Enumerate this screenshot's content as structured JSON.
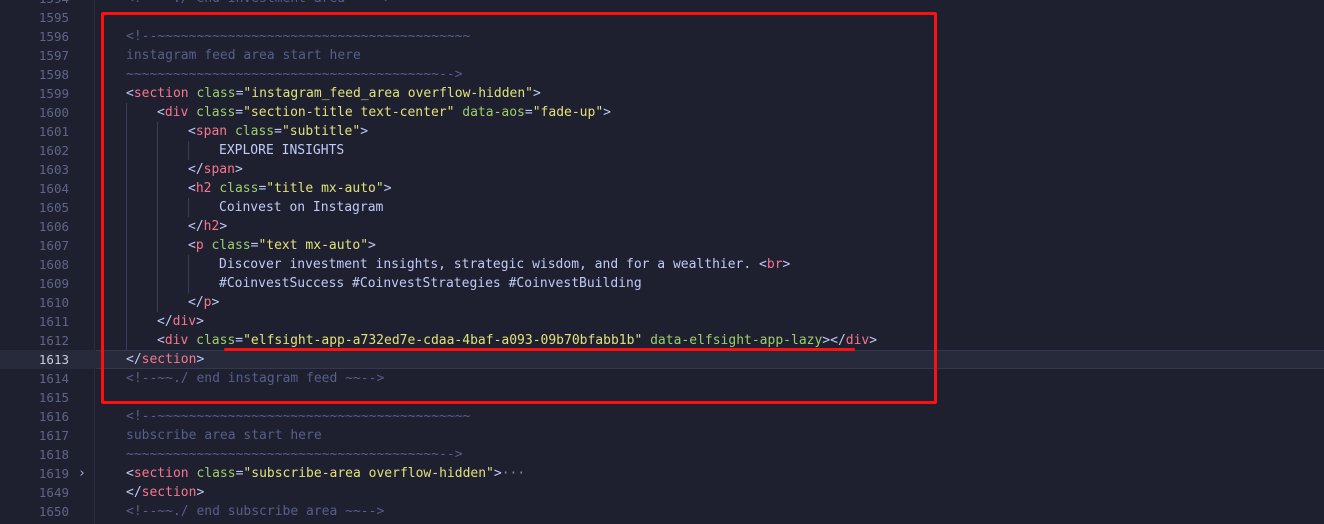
{
  "lines": [
    {
      "n": "1594",
      "indent": 0,
      "parts": [
        {
          "c": "c",
          "t": "<!--~~./ end investment area ~~-->"
        }
      ]
    },
    {
      "n": "1595",
      "indent": 0,
      "parts": []
    },
    {
      "n": "1596",
      "indent": 0,
      "parts": [
        {
          "c": "c",
          "t": "<!--~~~~~~~~~~~~~~~~~~~~~~~~~~~~~~~~~~~~~~~~"
        }
      ]
    },
    {
      "n": "1597",
      "indent": 0,
      "parts": [
        {
          "c": "c",
          "t": "instagram feed area start here"
        }
      ]
    },
    {
      "n": "1598",
      "indent": 0,
      "parts": [
        {
          "c": "c",
          "t": "~~~~~~~~~~~~~~~~~~~~~~~~~~~~~~~~~~~~~~~~-->"
        }
      ]
    },
    {
      "n": "1599",
      "indent": 0,
      "parts": [
        {
          "c": "p",
          "t": "<"
        },
        {
          "c": "t",
          "t": "section"
        },
        {
          "c": "tx",
          "t": " "
        },
        {
          "c": "a",
          "t": "class"
        },
        {
          "c": "p",
          "t": "="
        },
        {
          "c": "s",
          "t": "\"instagram_feed_area overflow-hidden\""
        },
        {
          "c": "p",
          "t": ">"
        }
      ]
    },
    {
      "n": "1600",
      "indent": 1,
      "parts": [
        {
          "c": "p",
          "t": "<"
        },
        {
          "c": "t",
          "t": "div"
        },
        {
          "c": "tx",
          "t": " "
        },
        {
          "c": "a",
          "t": "class"
        },
        {
          "c": "p",
          "t": "="
        },
        {
          "c": "s",
          "t": "\"section-title text-center\""
        },
        {
          "c": "tx",
          "t": " "
        },
        {
          "c": "a",
          "t": "data-aos"
        },
        {
          "c": "p",
          "t": "="
        },
        {
          "c": "s",
          "t": "\"fade-up\""
        },
        {
          "c": "p",
          "t": ">"
        }
      ]
    },
    {
      "n": "1601",
      "indent": 2,
      "parts": [
        {
          "c": "p",
          "t": "<"
        },
        {
          "c": "t",
          "t": "span"
        },
        {
          "c": "tx",
          "t": " "
        },
        {
          "c": "a",
          "t": "class"
        },
        {
          "c": "p",
          "t": "="
        },
        {
          "c": "s",
          "t": "\"subtitle\""
        },
        {
          "c": "p",
          "t": ">"
        }
      ]
    },
    {
      "n": "1602",
      "indent": 3,
      "parts": [
        {
          "c": "tx",
          "t": "EXPLORE INSIGHTS"
        }
      ]
    },
    {
      "n": "1603",
      "indent": 2,
      "parts": [
        {
          "c": "p",
          "t": "</"
        },
        {
          "c": "t",
          "t": "span"
        },
        {
          "c": "p",
          "t": ">"
        }
      ]
    },
    {
      "n": "1604",
      "indent": 2,
      "parts": [
        {
          "c": "p",
          "t": "<"
        },
        {
          "c": "t",
          "t": "h2"
        },
        {
          "c": "tx",
          "t": " "
        },
        {
          "c": "a",
          "t": "class"
        },
        {
          "c": "p",
          "t": "="
        },
        {
          "c": "s",
          "t": "\"title mx-auto\""
        },
        {
          "c": "p",
          "t": ">"
        }
      ]
    },
    {
      "n": "1605",
      "indent": 3,
      "parts": [
        {
          "c": "tx",
          "t": "Coinvest on Instagram"
        }
      ]
    },
    {
      "n": "1606",
      "indent": 2,
      "parts": [
        {
          "c": "p",
          "t": "</"
        },
        {
          "c": "t",
          "t": "h2"
        },
        {
          "c": "p",
          "t": ">"
        }
      ]
    },
    {
      "n": "1607",
      "indent": 2,
      "parts": [
        {
          "c": "p",
          "t": "<"
        },
        {
          "c": "t",
          "t": "p"
        },
        {
          "c": "tx",
          "t": " "
        },
        {
          "c": "a",
          "t": "class"
        },
        {
          "c": "p",
          "t": "="
        },
        {
          "c": "s",
          "t": "\"text mx-auto\""
        },
        {
          "c": "p",
          "t": ">"
        }
      ]
    },
    {
      "n": "1608",
      "indent": 3,
      "parts": [
        {
          "c": "tx",
          "t": "Discover investment insights, strategic wisdom, and for a wealthier. "
        },
        {
          "c": "p",
          "t": "<"
        },
        {
          "c": "t",
          "t": "br"
        },
        {
          "c": "p",
          "t": ">"
        }
      ]
    },
    {
      "n": "1609",
      "indent": 3,
      "parts": [
        {
          "c": "tx",
          "t": "#CoinvestSuccess #CoinvestStrategies #CoinvestBuilding"
        }
      ]
    },
    {
      "n": "1610",
      "indent": 2,
      "parts": [
        {
          "c": "p",
          "t": "</"
        },
        {
          "c": "t",
          "t": "p"
        },
        {
          "c": "p",
          "t": ">"
        }
      ]
    },
    {
      "n": "1611",
      "indent": 1,
      "parts": [
        {
          "c": "p",
          "t": "</"
        },
        {
          "c": "t",
          "t": "div"
        },
        {
          "c": "p",
          "t": ">"
        }
      ]
    },
    {
      "n": "1612",
      "indent": 1,
      "parts": [
        {
          "c": "p",
          "t": "<"
        },
        {
          "c": "t",
          "t": "div"
        },
        {
          "c": "tx",
          "t": " "
        },
        {
          "c": "a",
          "t": "class"
        },
        {
          "c": "p",
          "t": "="
        },
        {
          "c": "s",
          "t": "\"elfsight-app-a732ed7e-cdaa-4baf-a093-09b70bfabb1b\""
        },
        {
          "c": "tx",
          "t": " "
        },
        {
          "c": "a",
          "t": "data-elfsight-app-lazy"
        },
        {
          "c": "p",
          "t": "></"
        },
        {
          "c": "t",
          "t": "div"
        },
        {
          "c": "p",
          "t": ">"
        }
      ]
    },
    {
      "n": "1613",
      "indent": 0,
      "current": true,
      "parts": [
        {
          "c": "p",
          "t": "</"
        },
        {
          "c": "t",
          "t": "section"
        },
        {
          "c": "p",
          "t": ">"
        }
      ]
    },
    {
      "n": "1614",
      "indent": 0,
      "parts": [
        {
          "c": "c",
          "t": "<!--~~./ end instagram feed ~~-->"
        }
      ]
    },
    {
      "n": "1615",
      "indent": 0,
      "parts": []
    },
    {
      "n": "1616",
      "indent": 0,
      "parts": [
        {
          "c": "c",
          "t": "<!--~~~~~~~~~~~~~~~~~~~~~~~~~~~~~~~~~~~~~~~~"
        }
      ]
    },
    {
      "n": "1617",
      "indent": 0,
      "parts": [
        {
          "c": "c",
          "t": "subscribe area start here"
        }
      ]
    },
    {
      "n": "1618",
      "indent": 0,
      "parts": [
        {
          "c": "c",
          "t": "~~~~~~~~~~~~~~~~~~~~~~~~~~~~~~~~~~~~~~~~-->"
        }
      ]
    },
    {
      "n": "1619",
      "indent": 0,
      "folded": true,
      "parts": [
        {
          "c": "p",
          "t": "<"
        },
        {
          "c": "t",
          "t": "section"
        },
        {
          "c": "tx",
          "t": " "
        },
        {
          "c": "a",
          "t": "class"
        },
        {
          "c": "p",
          "t": "="
        },
        {
          "c": "s",
          "t": "\"subscribe-area overflow-hidden\""
        },
        {
          "c": "p",
          "t": ">"
        },
        {
          "c": "ell",
          "t": "···"
        }
      ]
    },
    {
      "n": "1649",
      "indent": 0,
      "parts": [
        {
          "c": "p",
          "t": "</"
        },
        {
          "c": "t",
          "t": "section"
        },
        {
          "c": "p",
          "t": ">"
        }
      ]
    },
    {
      "n": "1650",
      "indent": 0,
      "parts": [
        {
          "c": "c",
          "t": "<!--~~./ end subscribe area ~~-->"
        }
      ]
    }
  ],
  "fold_icon": "chevron-right-icon",
  "highlight_color": "#ff1010"
}
